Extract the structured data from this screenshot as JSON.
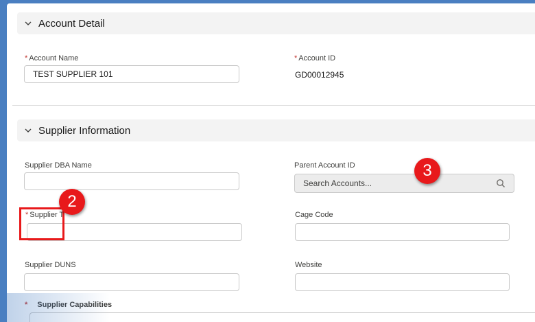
{
  "sections": {
    "account_detail": {
      "title": "Account Detail",
      "account_name": {
        "label": "Account Name",
        "value": "TEST SUPPLIER 101"
      },
      "account_id": {
        "label": "Account ID",
        "value": "GD00012945"
      }
    },
    "supplier_information": {
      "title": "Supplier Information",
      "supplier_dba_name": {
        "label": "Supplier DBA Name",
        "value": ""
      },
      "parent_account_id": {
        "label": "Parent Account ID",
        "placeholder": "Search Accounts..."
      },
      "supplier_type": {
        "label": "Supplier T",
        "value": ""
      },
      "cage_code": {
        "label": "Cage Code",
        "value": ""
      },
      "supplier_duns": {
        "label": "Supplier DUNS",
        "value": ""
      },
      "website": {
        "label": "Website",
        "value": ""
      },
      "supplier_capabilities": {
        "label": "Supplier Capabilities"
      }
    }
  },
  "annotations": {
    "marker_2": "2",
    "marker_3": "3"
  },
  "required_marker": "*",
  "colors": {
    "accent_red": "#e8191b",
    "required_red": "#c23934",
    "frame_blue": "#4a7fc1"
  },
  "icons": [
    "chevron-down-icon",
    "search-icon"
  ]
}
